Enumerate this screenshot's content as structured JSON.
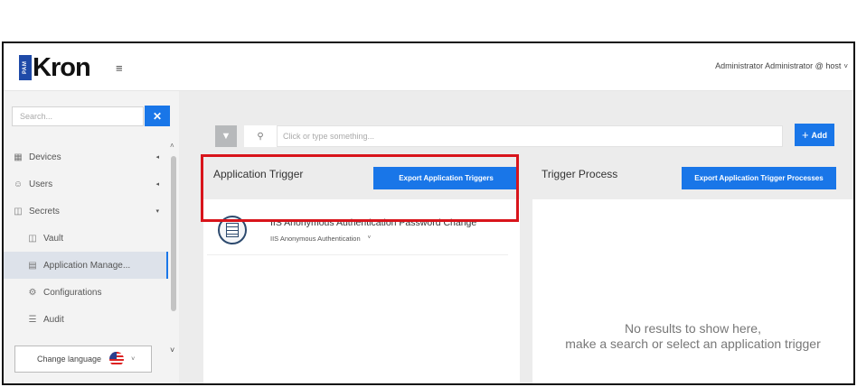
{
  "header": {
    "logo_badge": "PAM",
    "logo_text": "Kron",
    "user_label": "Administrator Administrator @ host",
    "user_caret": "˅"
  },
  "sidebar": {
    "search_placeholder": "Search...",
    "search_close": "✕",
    "items": [
      {
        "label": "Devices",
        "icon": "devices-icon",
        "arrow": "◂"
      },
      {
        "label": "Users",
        "icon": "user-icon",
        "arrow": "◂"
      },
      {
        "label": "Secrets",
        "icon": "secrets-icon",
        "arrow": "▾"
      },
      {
        "label": "Vault",
        "icon": "vault-icon"
      },
      {
        "label": "Application Manage...",
        "icon": "application-icon",
        "active": true
      },
      {
        "label": "Configurations",
        "icon": "configurations-icon"
      },
      {
        "label": "Audit",
        "icon": "audit-icon"
      }
    ],
    "language_label": "Change language",
    "language_caret": "˅"
  },
  "toolbar": {
    "search_placeholder": "Click or type something...",
    "add_label": "Add",
    "add_plus": "+"
  },
  "application_trigger": {
    "title": "Application Trigger",
    "export_label": "Export Application Triggers",
    "items": [
      {
        "title": "IIS Anonymous Authentication Password Change",
        "subtitle": "IIS Anonymous Authentication",
        "caret": "˅"
      }
    ]
  },
  "trigger_process": {
    "title": "Trigger Process",
    "export_label": "Export Application Trigger Processes",
    "empty_line1": "No results to show here,",
    "empty_line2": "make a search or select an application trigger"
  },
  "colors": {
    "accent": "#1976e8",
    "highlight": "#d8141b",
    "sidebar_bg": "#f3f3f3",
    "main_bg": "#ececec"
  }
}
